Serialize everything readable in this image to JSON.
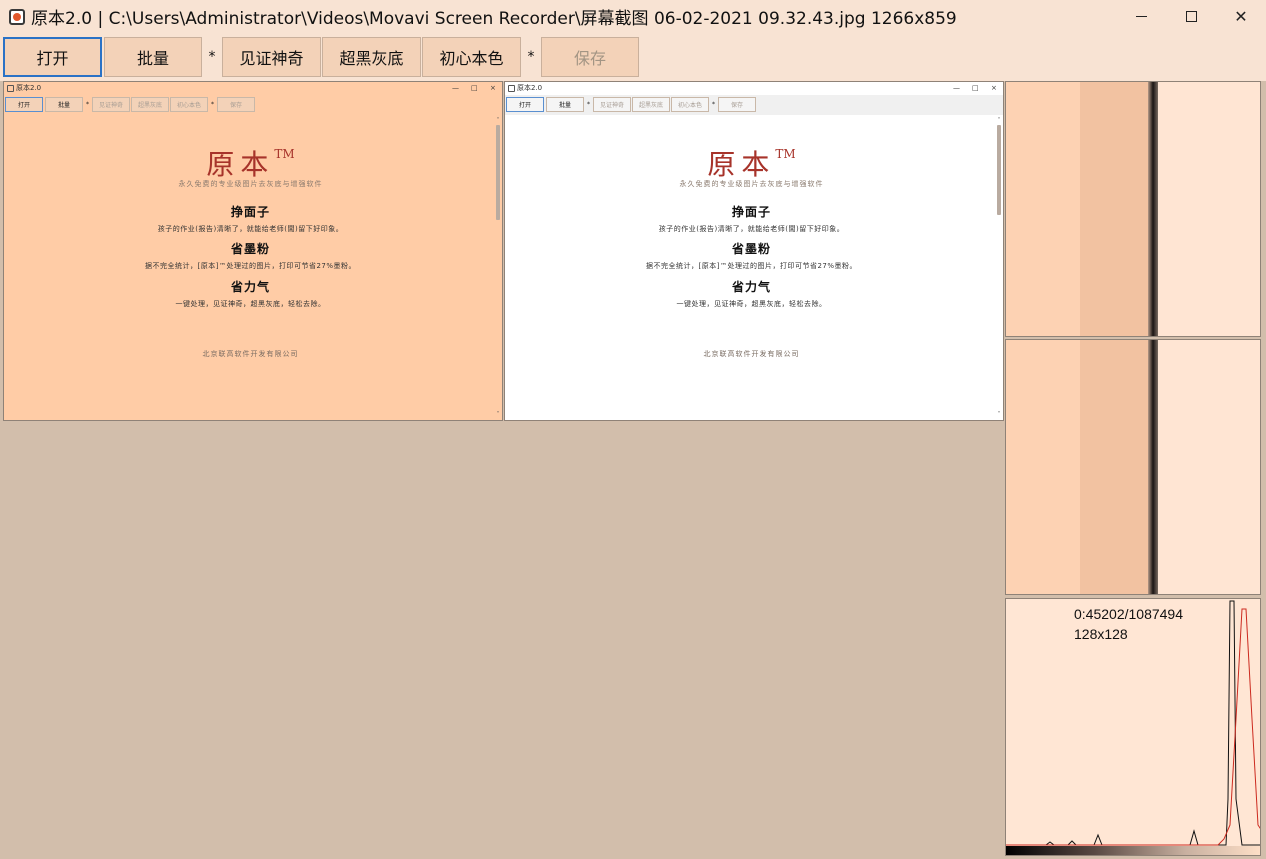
{
  "window": {
    "title": "原本2.0 | C:\\Users\\Administrator\\Videos\\Movavi Screen Recorder\\屏幕截图 06-02-2021 09.32.43.jpg 1266x859",
    "minimize_glyph": "—",
    "maximize_glyph": "☐",
    "close_glyph": "✕"
  },
  "toolbar": {
    "open": "打开",
    "batch": "批量",
    "sep1": "*",
    "miracle": "见证神奇",
    "superblack": "超黑灰底",
    "original": "初心本色",
    "sep2": "*",
    "save": "保存"
  },
  "preview": {
    "mini_title": "原本2.0",
    "mini_min": "—",
    "mini_max": "□",
    "mini_close": "×",
    "mini_toolbar": {
      "open": "打开",
      "batch": "批量",
      "sep1": "*",
      "miracle": "见证神奇",
      "superblack": "超黑灰底",
      "original": "初心本色",
      "sep2": "*",
      "save": "保存"
    },
    "doc": {
      "brand": "原本",
      "trademark": "TM",
      "subtitle": "永久免费的专业级图片去灰底与增强软件",
      "h1": "挣面子",
      "p1": "孩子的作业(报告)清晰了，就能给老师(闆)留下好印象。",
      "h2": "省墨粉",
      "p2": "据不完全统计，[原本]™处理过的图片，打印可节省27%墨粉。",
      "h3": "省力气",
      "p3": "一键处理，见证神奇，超黑灰底，轻松去除。",
      "footer": "北京联高软件开发有限公司"
    }
  },
  "histogram": {
    "count_text": "0:45202/1087494",
    "size_text": "128x128"
  },
  "colors": {
    "chrome": "#f8e3d3",
    "button": "#f3d2b8",
    "workspace": "#d2beab",
    "left_preview_bg": "#ffcca6",
    "right_preview_bg": "#ffffff",
    "brand_red": "#a7332a",
    "focus_blue": "#2a72c6"
  }
}
